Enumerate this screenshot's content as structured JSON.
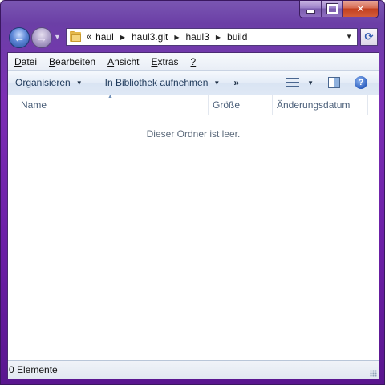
{
  "window": {
    "caption_buttons": [
      "minimize",
      "maximize",
      "close"
    ]
  },
  "navigation": {
    "address_overflow": "«",
    "breadcrumbs": [
      "haul",
      "haul3.git",
      "haul3",
      "build"
    ]
  },
  "menubar": {
    "items": [
      {
        "label": "Datei",
        "access_key": "D",
        "rest": "atei"
      },
      {
        "label": "Bearbeiten",
        "access_key": "B",
        "rest": "earbeiten"
      },
      {
        "label": "Ansicht",
        "access_key": "A",
        "rest": "nsicht"
      },
      {
        "label": "Extras",
        "access_key": "E",
        "rest": "xtras"
      },
      {
        "label": "?",
        "access_key": "?",
        "rest": ""
      }
    ]
  },
  "toolbar": {
    "organize_label": "Organisieren",
    "library_label": "In Bibliothek aufnehmen",
    "more_label": "»"
  },
  "columns": {
    "name": "Name",
    "size": "Größe",
    "date": "Änderungsdatum"
  },
  "content": {
    "empty_message": "Dieser Ordner ist leer."
  },
  "statusbar": {
    "text": "0 Elemente"
  }
}
